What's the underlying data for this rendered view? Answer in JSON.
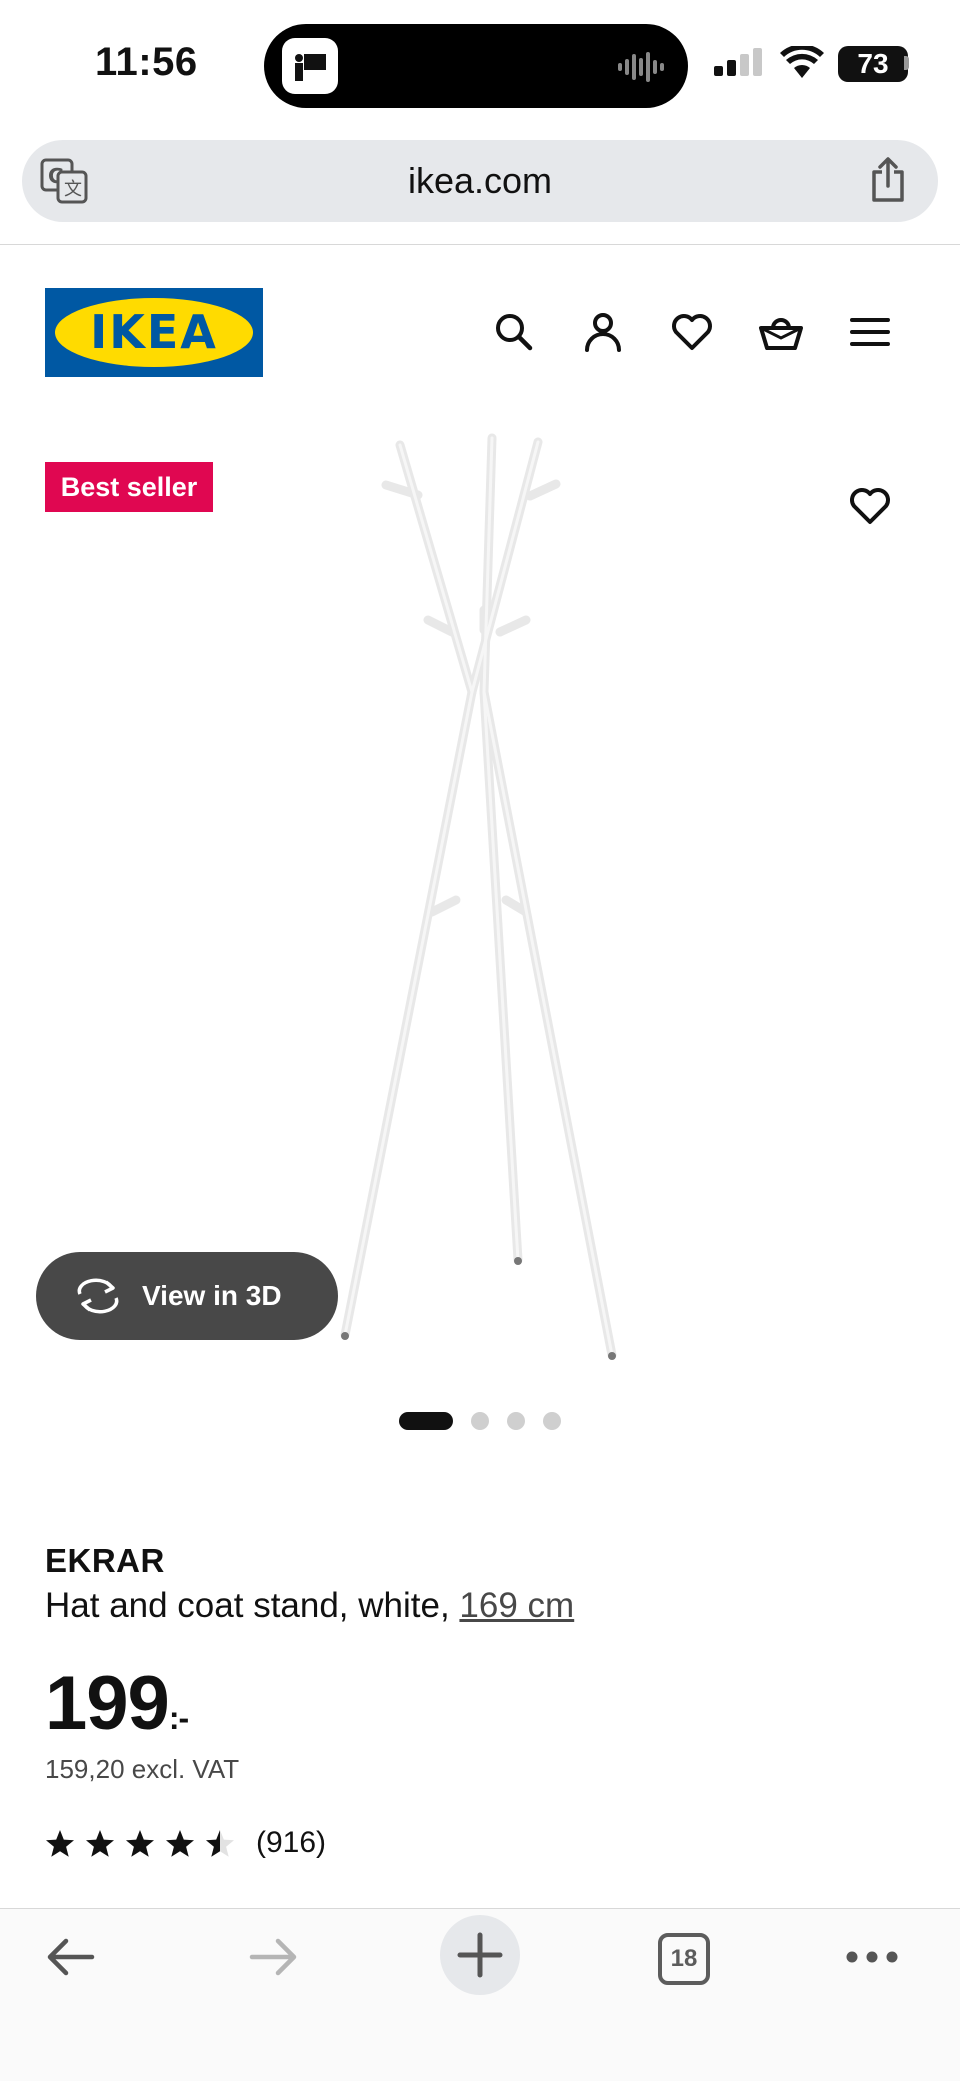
{
  "status_bar": {
    "time": "11:56",
    "battery": "73"
  },
  "browser": {
    "url": "ikea.com",
    "tabs_count": "18"
  },
  "site": {
    "logo_text": "IKEA",
    "header_icons": [
      "search-icon",
      "account-icon",
      "heart-icon",
      "basket-icon",
      "menu-icon"
    ],
    "brand_colors": {
      "blue": "#0058a3",
      "yellow": "#ffdb00",
      "badge": "#e00751"
    }
  },
  "product": {
    "badge": "Best seller",
    "view_3d_label": "View in 3D",
    "image_count": 4,
    "active_image": 1,
    "name": "EKRAR",
    "description": "Hat and coat stand, white, ",
    "size_link": "169 cm",
    "price": "199",
    "price_suffix": ":-",
    "price_excl_vat": "159,20 excl. VAT",
    "rating": 4.5,
    "reviews": "(916)"
  }
}
